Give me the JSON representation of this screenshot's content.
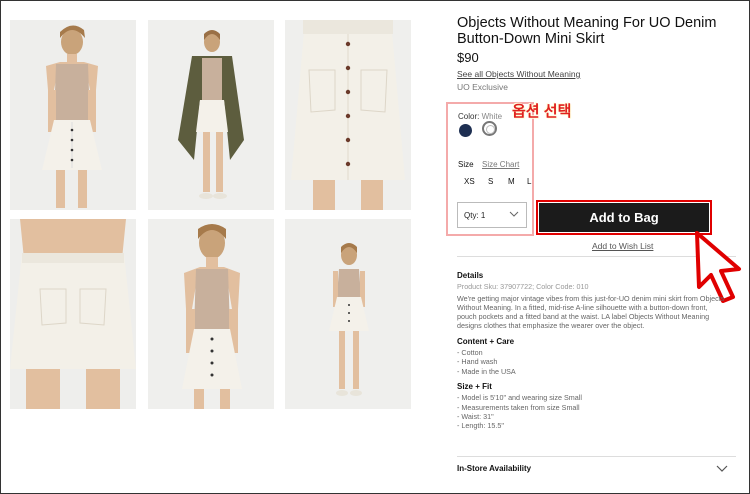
{
  "product": {
    "title": "Objects Without Meaning For UO Denim Button-Down Mini Skirt",
    "price": "$90",
    "brand_link": "See all Objects Without Meaning",
    "exclusive": "UO Exclusive"
  },
  "options": {
    "color_label": "Color:",
    "color_value": "White",
    "swatches": [
      "navy",
      "white"
    ],
    "size_label": "Size",
    "size_chart": "Size Chart",
    "sizes": [
      "XS",
      "S",
      "M",
      "L"
    ],
    "qty_label": "Qty: 1"
  },
  "annotation": "옵션 선택",
  "actions": {
    "add_to_bag": "Add to Bag",
    "wishlist": "Add to Wish List"
  },
  "details": {
    "title": "Details",
    "sku": "Product Sku: 37907722; Color Code: 010",
    "description": "We're getting major vintage vibes from this just-for-UO denim mini skirt from Objects Without Meaning. In a fitted, mid-rise A-line silhouette with a button-down front, pouch pockets and a fitted band at the waist. LA label Objects Without Meaning designs clothes that emphasize the wearer over the object."
  },
  "content_care": {
    "title": "Content + Care",
    "items": [
      "- Cotton",
      "- Hand wash",
      "- Made in the USA"
    ]
  },
  "size_fit": {
    "title": "Size + Fit",
    "items": [
      "- Model is 5'10\" and wearing size Small",
      "- Measurements taken from size Small",
      "- Waist: 31\"",
      "- Length: 15.5\""
    ]
  },
  "availability": "In-Store Availability",
  "colors": {
    "accent_red": "#e00000",
    "button_bg": "#1b1b1b",
    "swatch_navy": "#1e2f52"
  }
}
